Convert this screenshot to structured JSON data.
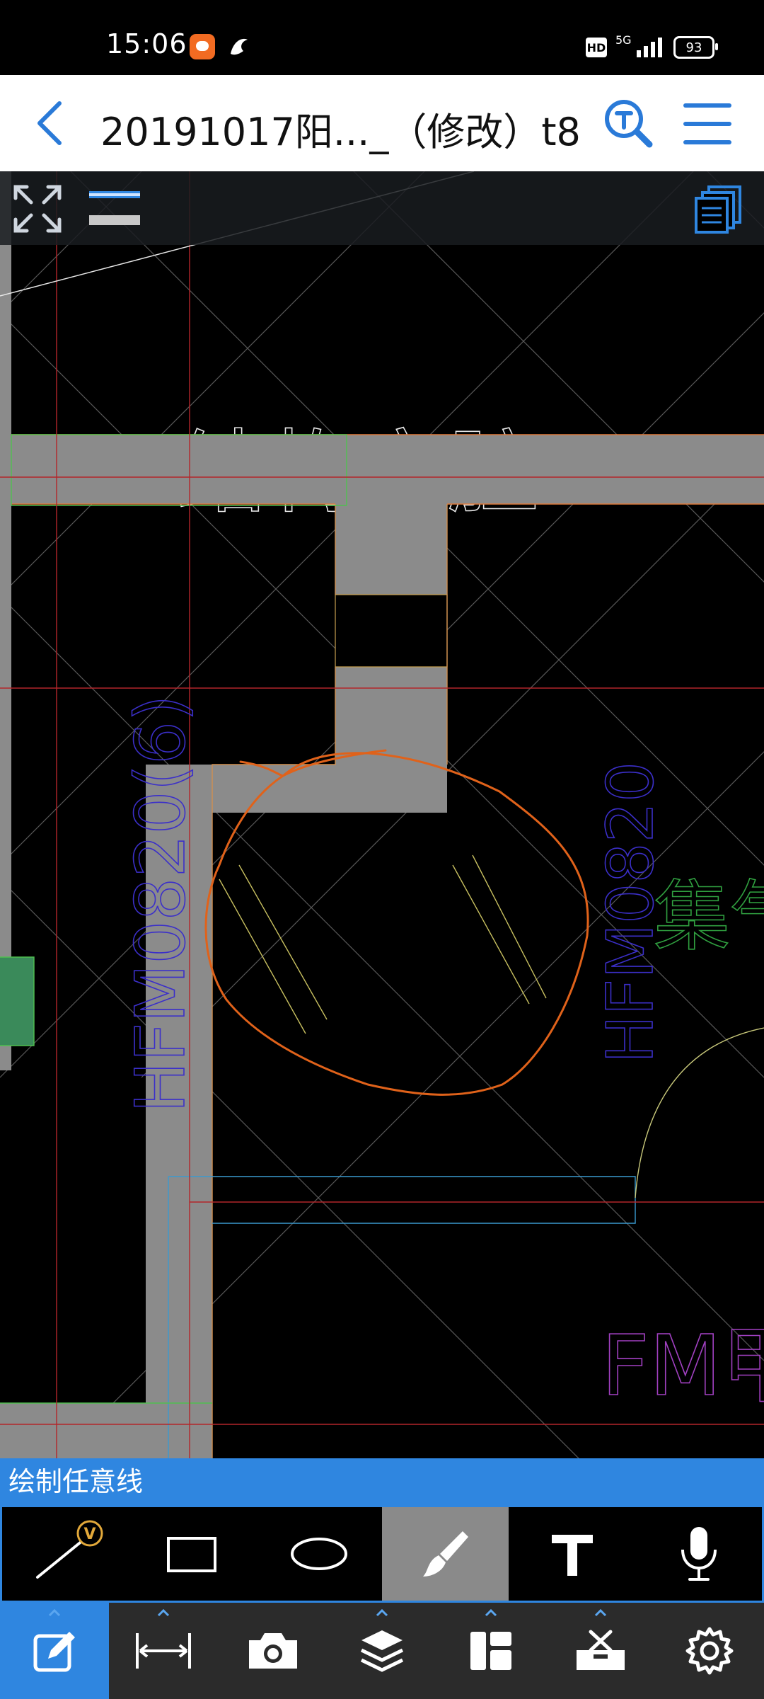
{
  "status_bar": {
    "time": "15:06",
    "network": "5G",
    "hd": "HD",
    "battery": "93"
  },
  "header": {
    "back_icon": "chevron-left-icon",
    "title": "20191017阳..._（修改）t8",
    "search_icon": "text-search-icon",
    "menu_icon": "hamburger-menu-icon"
  },
  "canvas": {
    "toolbar": {
      "fullscreen_icon": "expand-icon",
      "layer_icon": "layer-toggle-icon",
      "pages_icon": "pages-icon"
    },
    "labels": {
      "cavity": "结构空腔",
      "door_left": "HFM0820(6)",
      "door_right": "HFM0820",
      "room_name": "集气室",
      "door_bottom": "FM甲"
    },
    "colors": {
      "wall": "#8b8b8b",
      "markup_pen": "#e0621a",
      "grid_red": "#b3262a",
      "door_label": "#3b2fc9",
      "room_label": "#30a040",
      "fm_label": "#a040c0"
    }
  },
  "mode_label": "绘制任意线",
  "draw_tools": [
    {
      "name": "line-tool",
      "icon": "line-icon",
      "badge": "V"
    },
    {
      "name": "rectangle-tool",
      "icon": "rectangle-icon"
    },
    {
      "name": "ellipse-tool",
      "icon": "ellipse-icon"
    },
    {
      "name": "freehand-tool",
      "icon": "brush-icon",
      "active": true
    },
    {
      "name": "text-tool",
      "icon": "text-t-icon"
    },
    {
      "name": "voice-tool",
      "icon": "microphone-icon"
    }
  ],
  "bottom_nav": [
    {
      "name": "annotate",
      "icon": "edit-note-icon",
      "active": true
    },
    {
      "name": "measure",
      "icon": "measure-icon"
    },
    {
      "name": "camera",
      "icon": "camera-icon"
    },
    {
      "name": "layers",
      "icon": "layers-icon"
    },
    {
      "name": "layout",
      "icon": "layout-icon"
    },
    {
      "name": "tools",
      "icon": "toolbox-icon"
    },
    {
      "name": "settings",
      "icon": "gear-icon"
    }
  ]
}
